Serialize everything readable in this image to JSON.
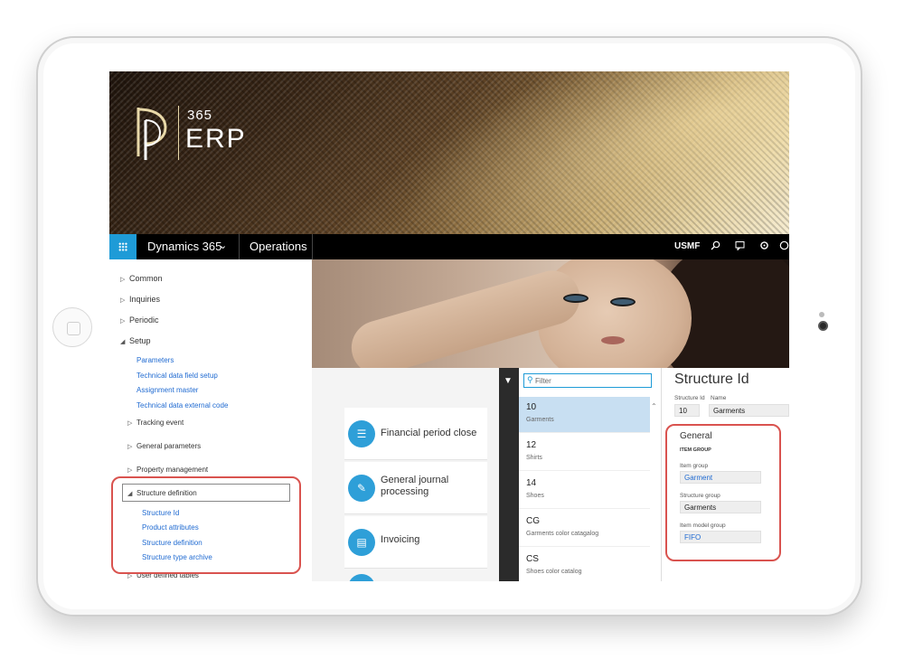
{
  "brand": {
    "number": "365",
    "name": "ERP"
  },
  "navbar": {
    "app_name": "Dynamics 365",
    "module": "Operations",
    "company": "USMF",
    "icons": [
      "waffle-icon",
      "search-icon",
      "message-icon",
      "settings-icon",
      "help-icon"
    ]
  },
  "nav_tree": {
    "top": [
      {
        "label": "Common",
        "state": "collapsed"
      },
      {
        "label": "Inquiries",
        "state": "collapsed"
      },
      {
        "label": "Periodic",
        "state": "collapsed"
      },
      {
        "label": "Setup",
        "state": "expanded"
      }
    ],
    "setup_links": [
      "Parameters",
      "Technical data field setup",
      "Assignment master",
      "Technical data external code"
    ],
    "more": [
      "Tracking event",
      "General parameters",
      "Property management"
    ],
    "structure_definition": "Structure definition",
    "structure_links": [
      "Structure Id",
      "Product attributes",
      "Structure definition",
      "Structure type archive"
    ],
    "last": "User defined tables"
  },
  "tiles": [
    {
      "label": "Financial period close",
      "icon": "list-icon"
    },
    {
      "label": "General journal processing",
      "icon": "journal-icon"
    },
    {
      "label": "Invoicing",
      "icon": "invoice-icon"
    }
  ],
  "list": {
    "filter_placeholder": "Filter",
    "rows": [
      {
        "id": "10",
        "name": "Garments",
        "selected": true
      },
      {
        "id": "12",
        "name": "Shirts",
        "selected": false
      },
      {
        "id": "14",
        "name": "Shoes",
        "selected": false
      },
      {
        "id": "CG",
        "name": "Garments color catagalog",
        "selected": false
      },
      {
        "id": "CS",
        "name": "Shoes color catalog",
        "selected": false
      }
    ]
  },
  "detail": {
    "title": "Structure Id",
    "structure_id_label": "Structure Id",
    "name_label": "Name",
    "structure_id_value": "10",
    "name_value": "Garments",
    "general_header": "General",
    "item_group_header": "ITEM GROUP",
    "item_group_label": "Item group",
    "item_group_value": "Garment",
    "structure_group_label": "Structure group",
    "structure_group_value": "Garments",
    "item_model_group_label": "Item model group",
    "item_model_group_value": "FIFO"
  },
  "colors": {
    "accent": "#1e9bd7",
    "highlight": "#d9534f",
    "link": "#1f6ad1",
    "selected_row": "#c8dff2"
  }
}
